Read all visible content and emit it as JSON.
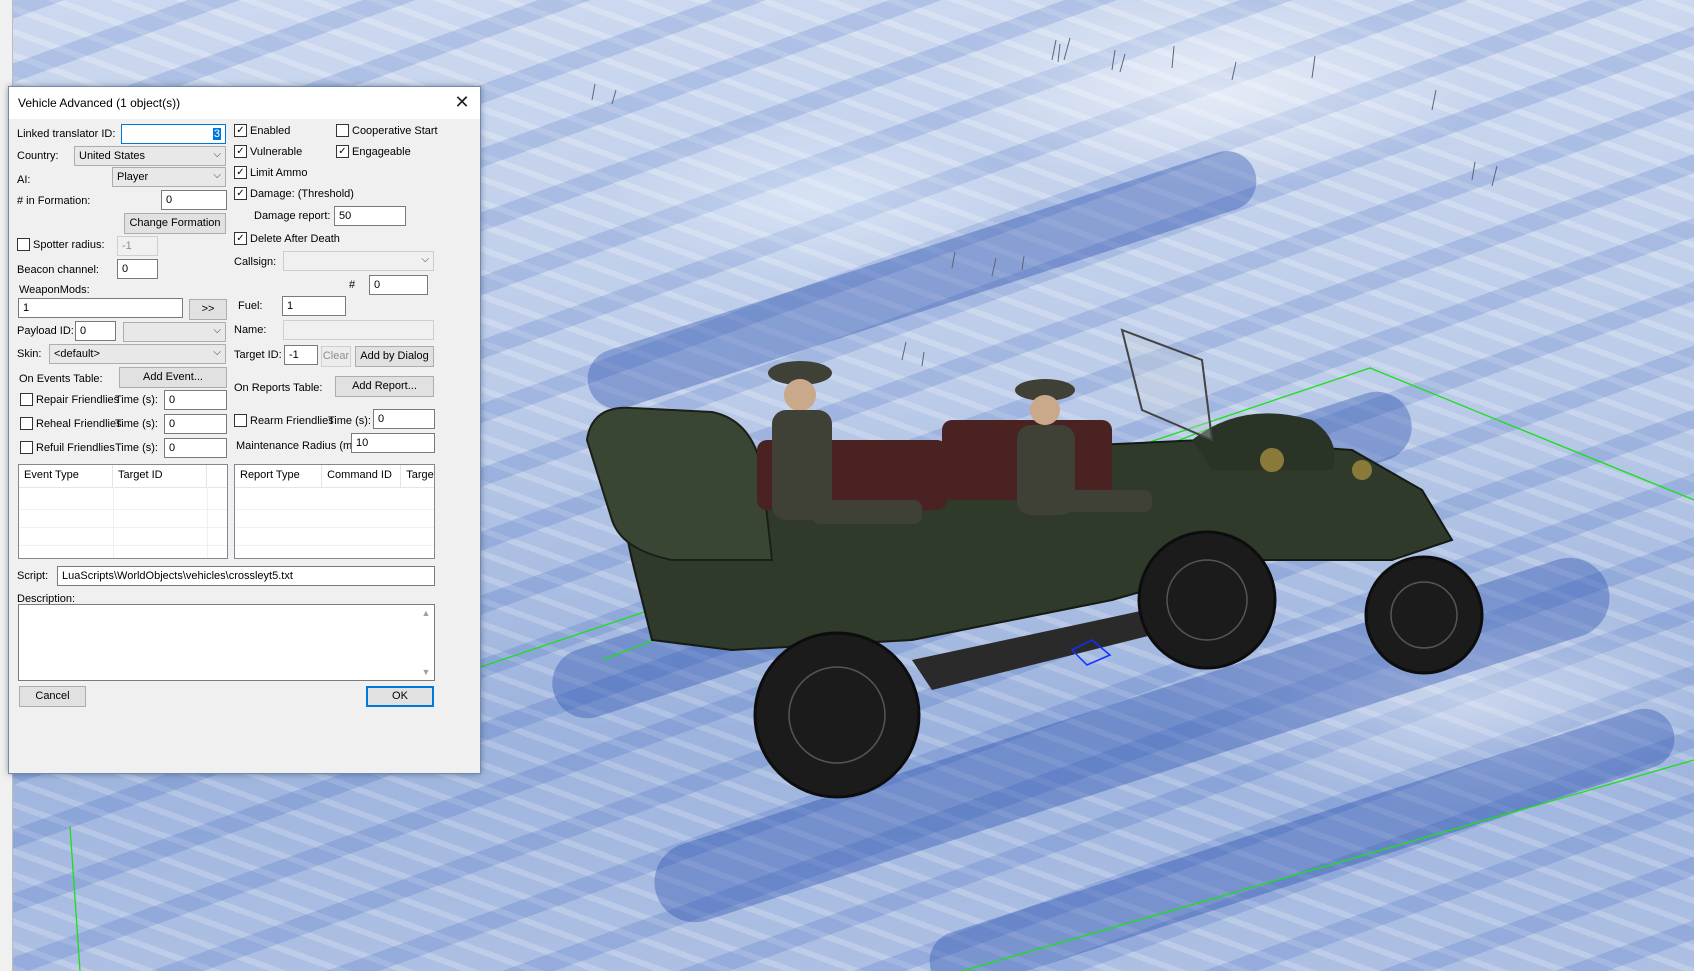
{
  "dialog": {
    "title": "Vehicle Advanced (1 object(s))",
    "close_glyph": "✕",
    "linked_translator_label": "Linked translator ID:",
    "linked_translator_value": "3",
    "country_label": "Country:",
    "country_value": "United States",
    "ai_label": "AI:",
    "ai_value": "Player",
    "in_formation_label": "# in Formation:",
    "in_formation_value": "0",
    "change_formation_button": "Change Formation",
    "spotter_radius_label": "Spotter radius:",
    "spotter_radius_checked": false,
    "spotter_radius_value": "-1",
    "beacon_channel_label": "Beacon channel:",
    "beacon_channel_value": "0",
    "weapon_mods_label": "WeaponMods:",
    "weapon_mods_value": "1",
    "weapon_mods_button": ">>",
    "payload_id_label": "Payload ID:",
    "payload_id_value": "0",
    "skin_label": "Skin:",
    "skin_value": "<default>",
    "on_events_label": "On Events Table:",
    "add_event_button": "Add Event...",
    "repair_label": "Repair Friendlies",
    "repair_checked": false,
    "reheal_label": "Reheal Friendlies",
    "reheal_checked": false,
    "refuil_label": "Refuil Friendlies",
    "refuil_checked": false,
    "time_label": "Time (s):",
    "repair_time": "0",
    "reheal_time": "0",
    "refuil_time": "0",
    "events_columns": [
      "Event Type",
      "Target ID"
    ],
    "enabled_label": "Enabled",
    "enabled_checked": true,
    "cooperative_label": "Cooperative Start",
    "cooperative_checked": false,
    "vulnerable_label": "Vulnerable",
    "vulnerable_checked": true,
    "engageable_label": "Engageable",
    "engageable_checked": true,
    "limit_ammo_label": "Limit Ammo",
    "limit_ammo_checked": true,
    "damage_label": "Damage: (Threshold)",
    "damage_checked": true,
    "damage_report_label": "Damage report:",
    "damage_report_value": "50",
    "delete_after_label": "Delete After Death",
    "delete_after_checked": true,
    "callsign_label": "Callsign:",
    "callsign_value": "",
    "hash_label": "#",
    "hash_value": "0",
    "fuel_label": "Fuel:",
    "fuel_value": "1",
    "name_label": "Name:",
    "name_value": "",
    "target_id_label": "Target ID:",
    "target_id_value": "-1",
    "clear_button": "Clear",
    "add_by_dialog_button": "Add by Dialog",
    "on_reports_label": "On Reports Table:",
    "add_report_button": "Add Report...",
    "rearm_label": "Rearm Friendlies",
    "rearm_checked": false,
    "rearm_time": "0",
    "maintenance_label": "Maintenance Radius (m):",
    "maintenance_value": "10",
    "reports_columns": [
      "Report Type",
      "Command ID",
      "Targe"
    ],
    "script_label": "Script:",
    "script_value": "LuaScripts\\WorldObjects\\vehicles\\crossleyt5.txt",
    "description_label": "Description:",
    "description_value": "",
    "cancel_button": "Cancel",
    "ok_button": "OK"
  },
  "icons": {
    "check": "✓",
    "dropdown": "⌵",
    "scroll_up": "▲",
    "scroll_down": "▼"
  }
}
